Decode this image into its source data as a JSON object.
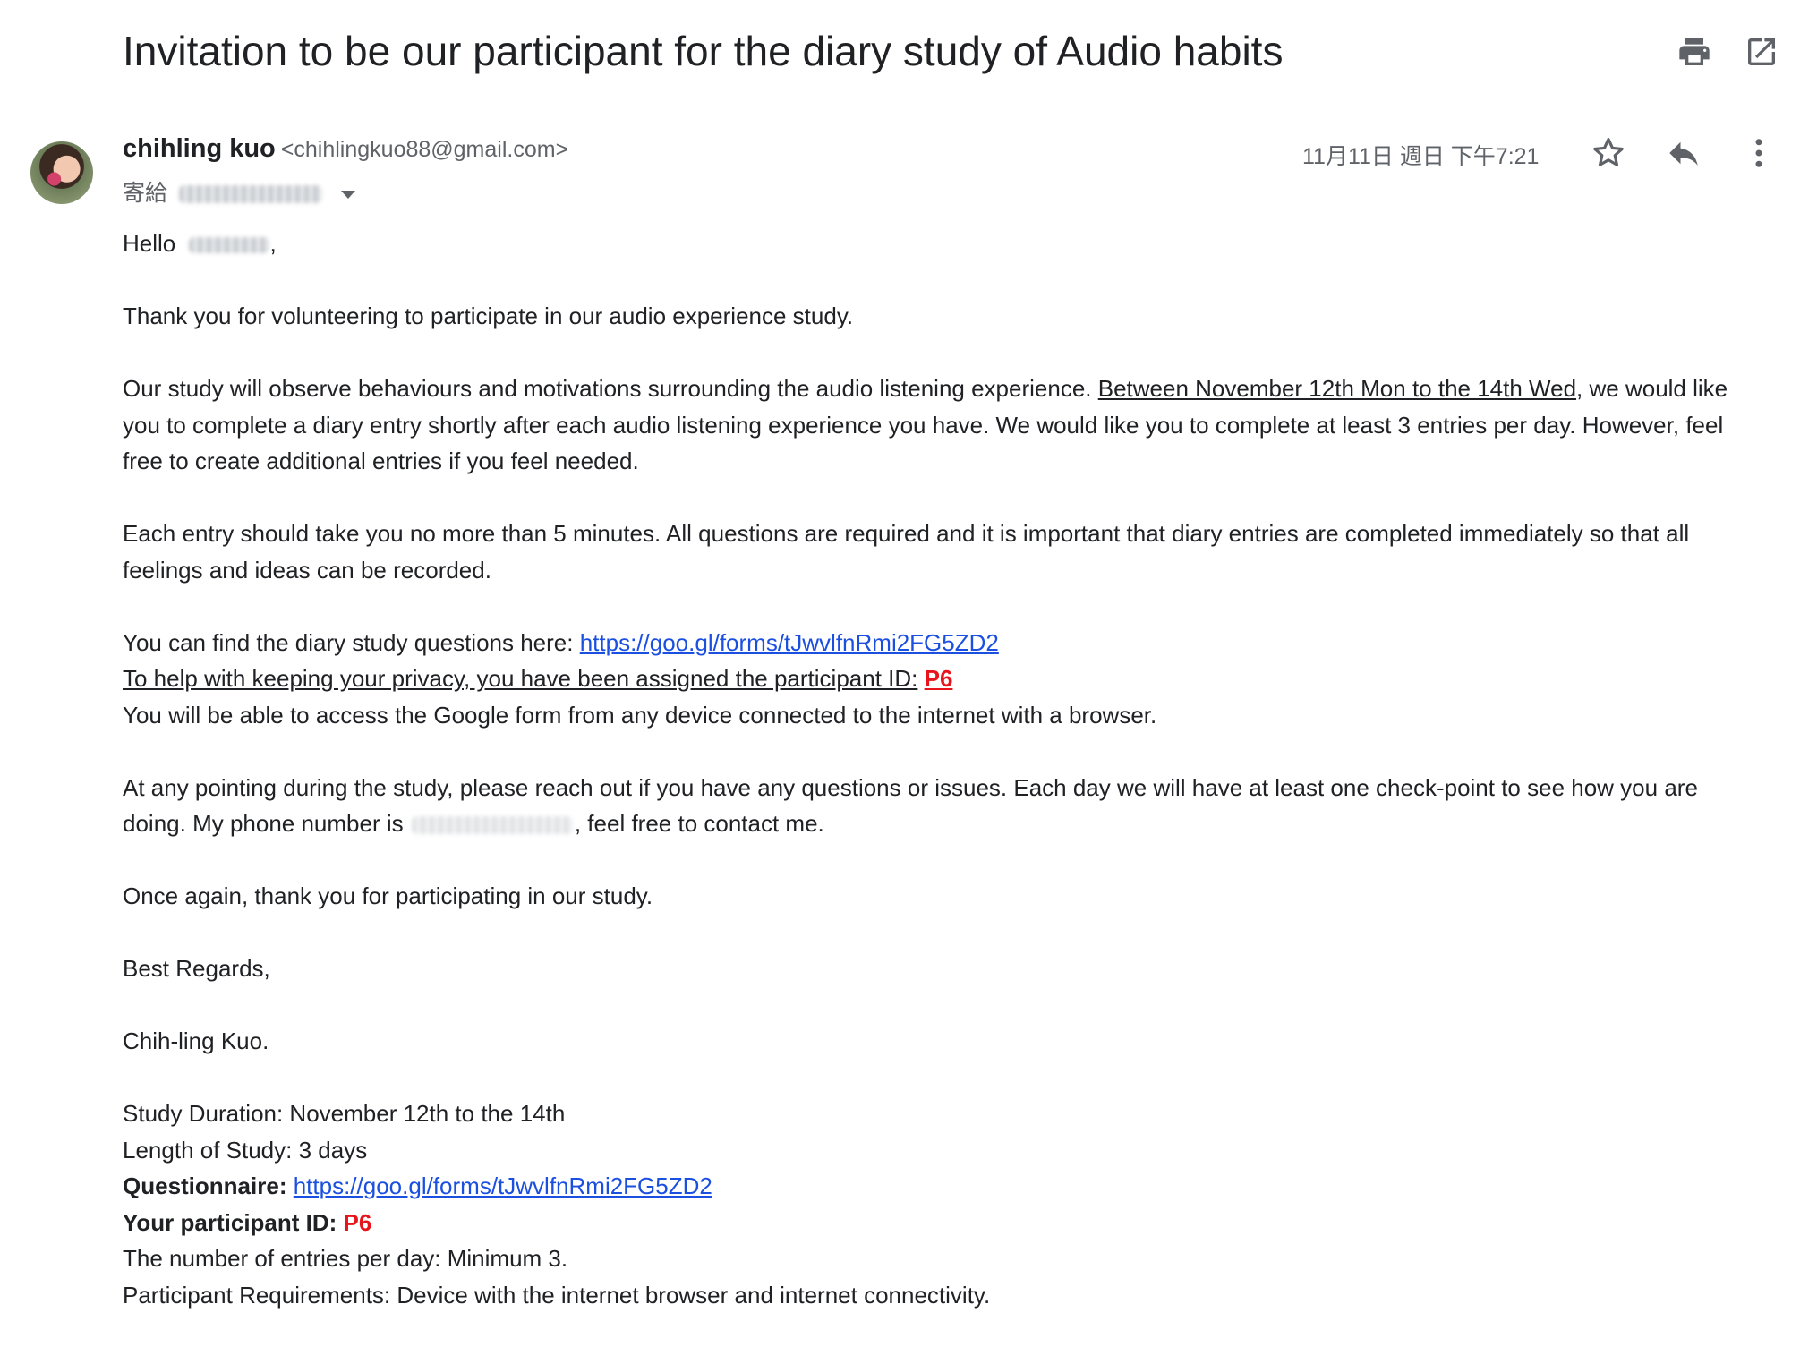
{
  "email": {
    "subject": "Invitation to be our participant for the diary study of Audio habits",
    "sender_name": "chihling kuo",
    "sender_email": "<chihlingkuo88@gmail.com>",
    "to_label": "寄給",
    "date": "11月11日 週日 下午7:21"
  },
  "toolbar_icons": [
    "print-icon",
    "open-in-new-window-icon",
    "star-icon",
    "reply-icon",
    "more-vert-icon"
  ],
  "colors": {
    "link": "#1a4fe0",
    "participant_id": "#e8141b",
    "meta_text": "#5f6368"
  },
  "body": {
    "greeting": "Hello",
    "greeting_end": ",",
    "p1": "Thank you for volunteering to participate in our audio experience study.",
    "p2_a": "Our study will observe behaviours and motivations surrounding the audio listening experience.",
    "p2_underlined": "Between November 12th Mon to the 14th Wed",
    "p2_b": ", we would like you to complete a diary entry shortly after each audio listening experience you have. We would like you to complete at least 3 entries per day. However, feel free to create additional entries if you feel needed.",
    "p3": "Each entry should take you no more than 5 minutes. All questions are required and it is important that diary entries are completed immediately so that all feelings and ideas can be recorded.",
    "p4_line1": "You can find the diary study questions here:",
    "form_link": "https://goo.gl/forms/tJwvlfnRmi2FG5ZD2",
    "p4_line2": "To help with keeping your privacy, you have been assigned the participant ID:",
    "participant_id": "P6",
    "p4_line3": "You will be able to access the Google form from any device connected to the internet with a browser.",
    "p5_a": "At any pointing during the study, please reach out if you have any questions or issues. Each day we will have at least one check-point to see how you are doing. My phone number is",
    "p5_b": ", feel free to contact me.",
    "p6": "Once again, thank you for participating in our study.",
    "p7": "Best Regards,",
    "p8": "Chih-ling Kuo."
  },
  "summary": {
    "duration": "Study Duration: November 12th to the 14th",
    "length": "Length of Study: 3 days",
    "questionnaire_label": "Questionnaire:",
    "questionnaire_link": "https://goo.gl/forms/tJwvlfnRmi2FG5ZD2",
    "participant_id_label": "Your participant ID:",
    "participant_id": "P6",
    "entries": "The number of entries per day: Minimum 3.",
    "requirements": "Participant Requirements: Device with the internet browser and internet connectivity."
  }
}
